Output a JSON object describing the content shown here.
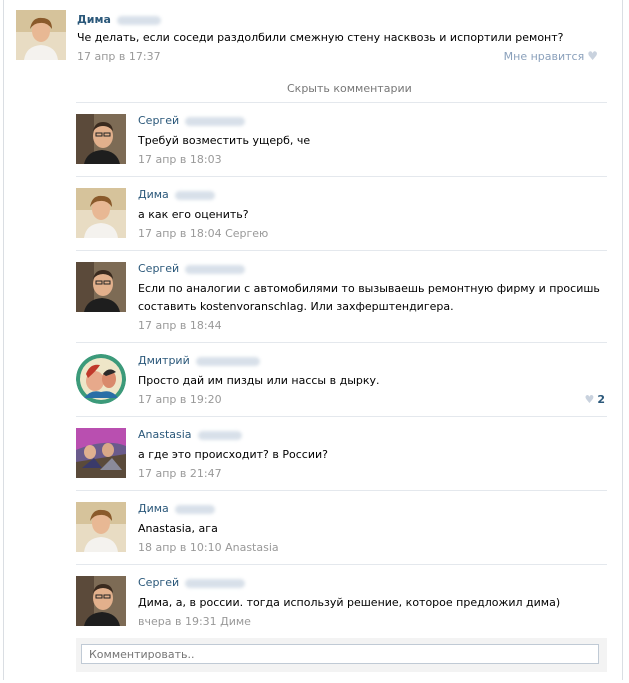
{
  "post": {
    "author": "Дима",
    "text": "Че делать, если соседи раздолбили смежную стену насквозь и испортили ремонт?",
    "date": "17 апр в 17:37",
    "like_label": "Мне нравится"
  },
  "hide_comments": "Скрыть комментарии",
  "comments": [
    {
      "author": "Сергей",
      "text": "Требуй возместить ущерб, че",
      "date": "17 апр в 18:03"
    },
    {
      "author": "Дима",
      "text": "а как его оценить?",
      "date": "17 апр в 18:04 Сергею"
    },
    {
      "author": "Сергей",
      "text": "Если по аналогии с автомобилями то вызываешь ремонтную фирму и просишь составить kostenvoranschlag. Или захферштендигера.",
      "date": "17 апр в 18:44"
    },
    {
      "author": "Дмитрий",
      "text": "Просто дай им пизды или нассы в дырку.",
      "date": "17 апр в 19:20",
      "likes": "2"
    },
    {
      "author": "Anastasia",
      "text": "а где это происходит? в России?",
      "date": "17 апр в 21:47"
    },
    {
      "author": "Дима",
      "text": "Anastasia, ага",
      "date": "18 апр в 10:10 Anastasia"
    },
    {
      "author": "Сергей",
      "text": "Дима, а, в россии. тогда используй решение, которое предложил дима)",
      "date": "вчера в 19:31 Диме"
    }
  ],
  "reply": {
    "placeholder": "Комментировать.."
  },
  "colors": {
    "link": "#2b587a",
    "muted": "#999999",
    "separator": "#e4e8ed"
  }
}
